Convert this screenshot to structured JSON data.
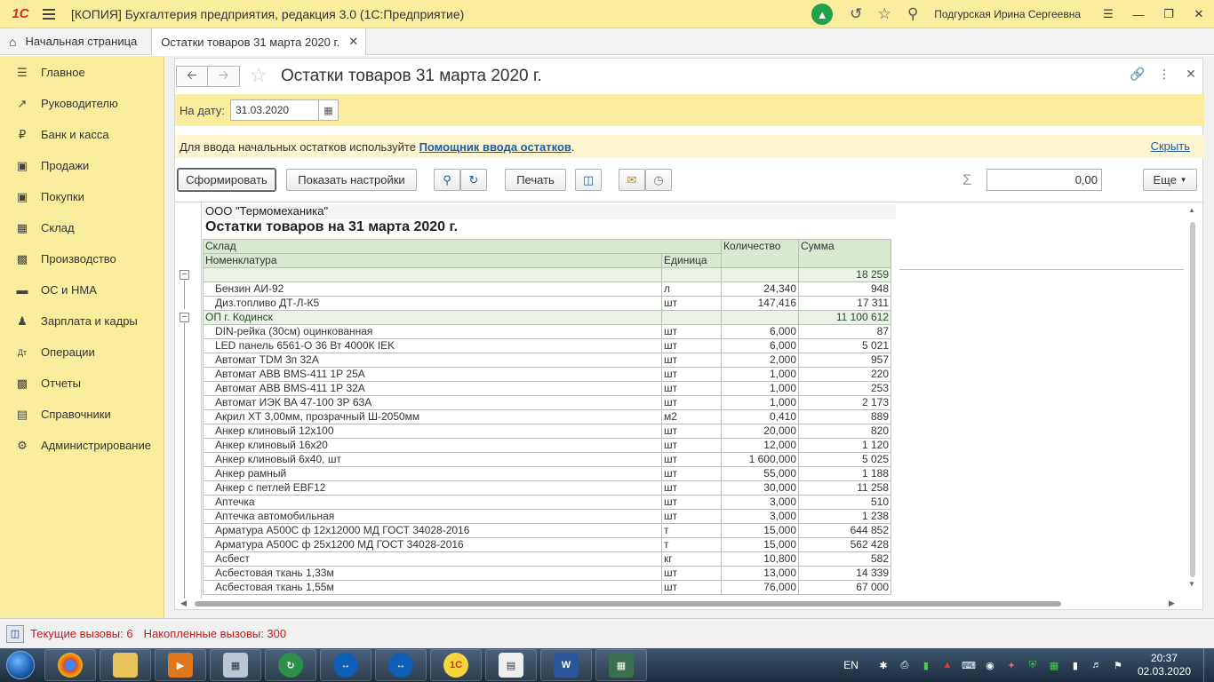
{
  "titlebar": {
    "app_title": "[КОПИЯ] Бухгалтерия предприятия, редакция 3.0  (1С:Предприятие)",
    "user": "Подгурская Ирина Сергеевна"
  },
  "tabs": {
    "home": "Начальная страница",
    "doc": "Остатки товаров 31 марта 2020 г."
  },
  "sidebar": {
    "items": [
      {
        "label": "Главное",
        "icon": "menu-icon"
      },
      {
        "label": "Руководителю",
        "icon": "trend-icon"
      },
      {
        "label": "Банк и касса",
        "icon": "coin-icon"
      },
      {
        "label": "Продажи",
        "icon": "bag-icon"
      },
      {
        "label": "Покупки",
        "icon": "cart-icon"
      },
      {
        "label": "Склад",
        "icon": "warehouse-icon"
      },
      {
        "label": "Производство",
        "icon": "factory-icon"
      },
      {
        "label": "ОС и НМА",
        "icon": "truck-icon"
      },
      {
        "label": "Зарплата и кадры",
        "icon": "person-icon"
      },
      {
        "label": "Операции",
        "icon": "dt-kt-icon"
      },
      {
        "label": "Отчеты",
        "icon": "bar-chart-icon"
      },
      {
        "label": "Справочники",
        "icon": "book-icon"
      },
      {
        "label": "Администрирование",
        "icon": "gear-icon"
      }
    ]
  },
  "form": {
    "title": "Остатки товаров 31 марта 2020 г.",
    "date_label": "На дату:",
    "date_value": "31.03.2020",
    "info_text": "Для ввода начальных остатков используйте ",
    "info_link": "Помощник ввода остатков",
    "info_dot": ".",
    "hide_link": "Скрыть",
    "btn_generate": "Сформировать",
    "btn_settings": "Показать настройки",
    "btn_print": "Печать",
    "sum_value": "0,00",
    "btn_more": "Еще"
  },
  "report": {
    "company": "ООО \"Термомеханика\"",
    "title": "Остатки товаров на 31 марта 2020 г.",
    "col_warehouse": "Склад",
    "col_nomenclature": "Номенклатура",
    "col_unit": "Единица",
    "col_qty": "Количество",
    "col_sum": "Сумма",
    "rows": [
      {
        "type": "group",
        "name": "",
        "unit": "",
        "qty": "",
        "sum": "18 259"
      },
      {
        "type": "item",
        "name": "Бензин АИ-92",
        "unit": "л",
        "qty": "24,340",
        "sum": "948"
      },
      {
        "type": "item",
        "name": "Диз.топливо ДТ-Л-К5",
        "unit": "шт",
        "qty": "147,416",
        "sum": "17 311"
      },
      {
        "type": "group",
        "name": "ОП г. Кодинск",
        "unit": "",
        "qty": "",
        "sum": "11 100 612"
      },
      {
        "type": "item",
        "name": "DIN-рейка (30см) оцинкованная",
        "unit": "шт",
        "qty": "6,000",
        "sum": "87"
      },
      {
        "type": "item",
        "name": "LED панель 6561-О 36 Вт 4000К IEK",
        "unit": "шт",
        "qty": "6,000",
        "sum": "5 021"
      },
      {
        "type": "item",
        "name": "Автомат TDM 3п 32А",
        "unit": "шт",
        "qty": "2,000",
        "sum": "957"
      },
      {
        "type": "item",
        "name": "Автомат ABB BMS-411 1Р 25А",
        "unit": "шт",
        "qty": "1,000",
        "sum": "220"
      },
      {
        "type": "item",
        "name": "Автомат ABB BMS-411 1Р 32А",
        "unit": "шт",
        "qty": "1,000",
        "sum": "253"
      },
      {
        "type": "item",
        "name": "Автомат ИЭК ВА 47-100 3Р 63А",
        "unit": "шт",
        "qty": "1,000",
        "sum": "2 173"
      },
      {
        "type": "item",
        "name": "Акрил ХТ 3,00мм, прозрачный Ш-2050мм",
        "unit": "м2",
        "qty": "0,410",
        "sum": "889"
      },
      {
        "type": "item",
        "name": "Анкер клиновый 12х100",
        "unit": "шт",
        "qty": "20,000",
        "sum": "820"
      },
      {
        "type": "item",
        "name": "Анкер клиновый 16х20",
        "unit": "шт",
        "qty": "12,000",
        "sum": "1 120"
      },
      {
        "type": "item",
        "name": "Анкер клиновый 6х40, шт",
        "unit": "шт",
        "qty": "1 600,000",
        "sum": "5 025"
      },
      {
        "type": "item",
        "name": "Анкер рамный",
        "unit": "шт",
        "qty": "55,000",
        "sum": "1 188"
      },
      {
        "type": "item",
        "name": "Анкер с петлей EBF12",
        "unit": "шт",
        "qty": "30,000",
        "sum": "11 258"
      },
      {
        "type": "item",
        "name": "Аптечка",
        "unit": "шт",
        "qty": "3,000",
        "sum": "510"
      },
      {
        "type": "item",
        "name": "Аптечка автомобильная",
        "unit": "шт",
        "qty": "3,000",
        "sum": "1 238"
      },
      {
        "type": "item",
        "name": "Арматура А500С ф 12х12000 МД ГОСТ 34028-2016",
        "unit": "т",
        "qty": "15,000",
        "sum": "644 852"
      },
      {
        "type": "item",
        "name": "Арматура А500С ф 25х1200 МД ГОСТ 34028-2016",
        "unit": "т",
        "qty": "15,000",
        "sum": "562 428"
      },
      {
        "type": "item",
        "name": "Асбест",
        "unit": "кг",
        "qty": "10,800",
        "sum": "582"
      },
      {
        "type": "item",
        "name": "Асбестовая ткань 1,33м",
        "unit": "шт",
        "qty": "13,000",
        "sum": "14 339"
      },
      {
        "type": "item",
        "name": "Асбестовая ткань 1,55м",
        "unit": "шт",
        "qty": "76,000",
        "sum": "67 000"
      }
    ]
  },
  "status": {
    "current_calls": "Текущие вызовы: 6",
    "accumulated_calls": "Накопленные вызовы: 300"
  },
  "taskbar": {
    "lang": "EN",
    "time": "20:37",
    "date": "02.03.2020",
    "apps": [
      "chrome",
      "explorer",
      "media-player",
      "calculator",
      "teamviewer-update",
      "teamviewer",
      "teamviewer",
      "1c",
      "1c-configurator",
      "word",
      "task-manager"
    ]
  }
}
